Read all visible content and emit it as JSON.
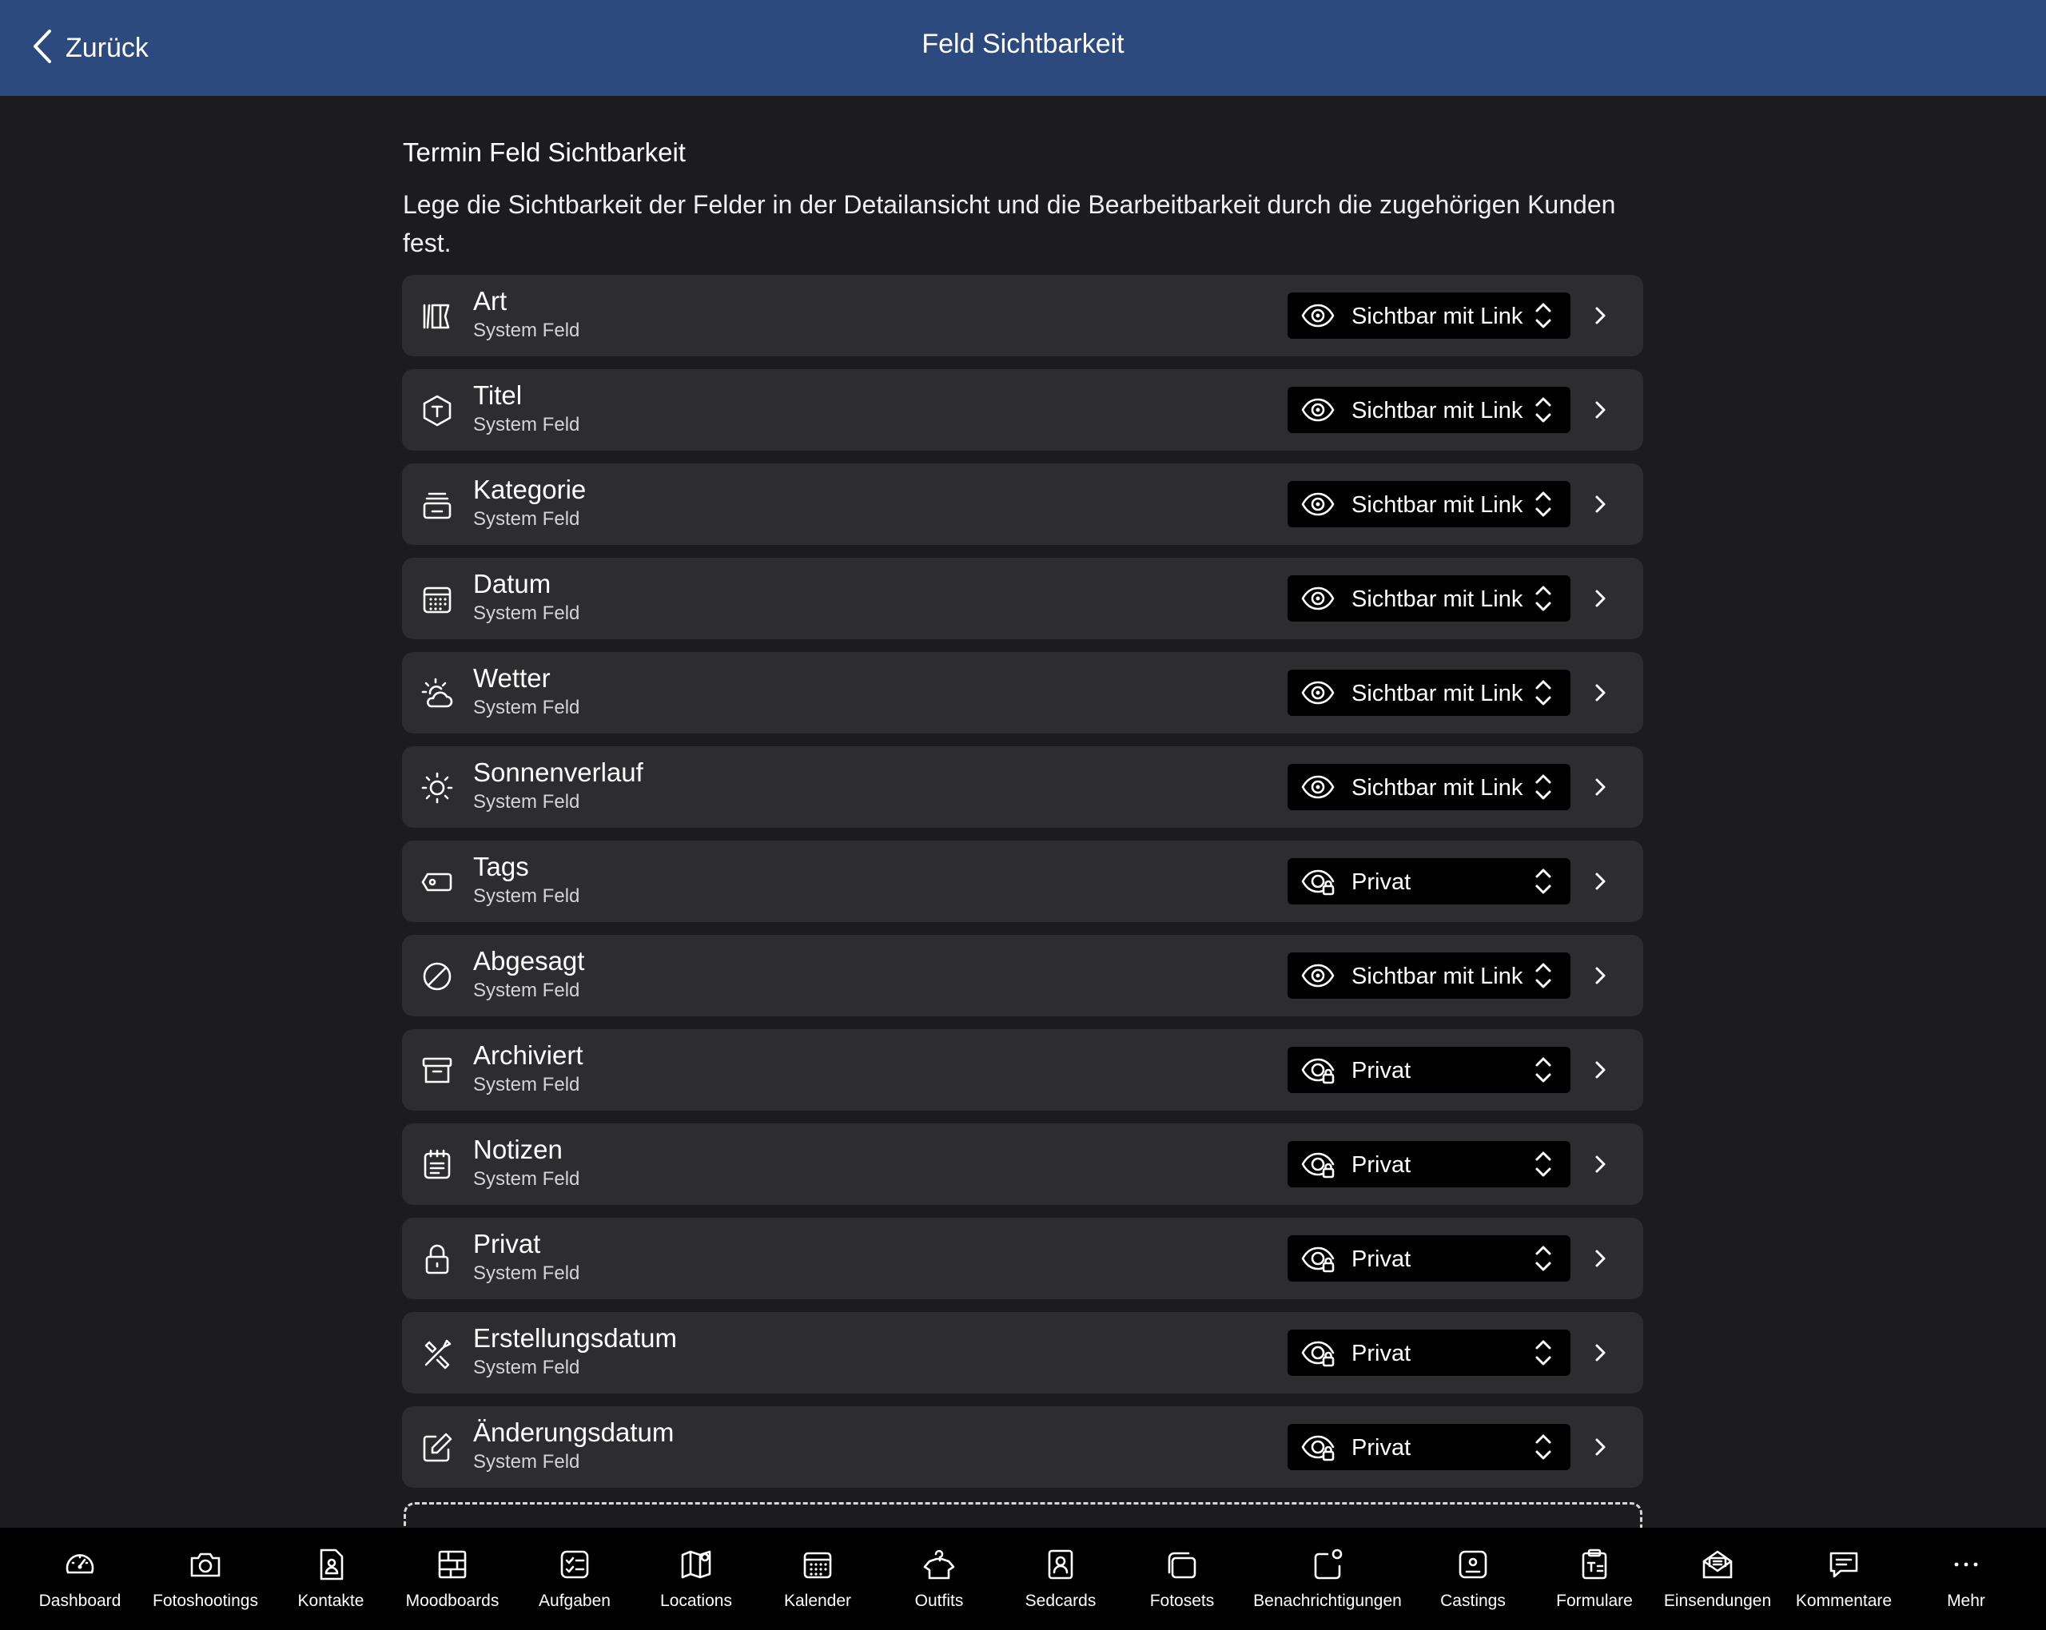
{
  "header": {
    "back_label": "Zurück",
    "title": "Feld Sichtbarkeit"
  },
  "section": {
    "title": "Termin Feld Sichtbarkeit",
    "description": "Lege die Sichtbarkeit der Felder in der Detailansicht und die Bearbeitbarkeit durch die zugehörigen Kunden fest."
  },
  "fields": [
    {
      "name": "Art",
      "subtitle": "System Feld",
      "icon": "columns-icon",
      "visibility": "Sichtbar mit Link",
      "visibility_icon": "eye-icon"
    },
    {
      "name": "Titel",
      "subtitle": "System Feld",
      "icon": "title-hexagon-icon",
      "visibility": "Sichtbar mit Link",
      "visibility_icon": "eye-icon"
    },
    {
      "name": "Kategorie",
      "subtitle": "System Feld",
      "icon": "category-stack-icon",
      "visibility": "Sichtbar mit Link",
      "visibility_icon": "eye-icon"
    },
    {
      "name": "Datum",
      "subtitle": "System Feld",
      "icon": "calendar-icon",
      "visibility": "Sichtbar mit Link",
      "visibility_icon": "eye-icon"
    },
    {
      "name": "Wetter",
      "subtitle": "System Feld",
      "icon": "weather-icon",
      "visibility": "Sichtbar mit Link",
      "visibility_icon": "eye-icon"
    },
    {
      "name": "Sonnenverlauf",
      "subtitle": "System Feld",
      "icon": "sun-icon",
      "visibility": "Sichtbar mit Link",
      "visibility_icon": "eye-icon"
    },
    {
      "name": "Tags",
      "subtitle": "System Feld",
      "icon": "tag-icon",
      "visibility": "Privat",
      "visibility_icon": "eye-lock-icon"
    },
    {
      "name": "Abgesagt",
      "subtitle": "System Feld",
      "icon": "cancelled-icon",
      "visibility": "Sichtbar mit Link",
      "visibility_icon": "eye-icon"
    },
    {
      "name": "Archiviert",
      "subtitle": "System Feld",
      "icon": "archive-icon",
      "visibility": "Privat",
      "visibility_icon": "eye-lock-icon"
    },
    {
      "name": "Notizen",
      "subtitle": "System Feld",
      "icon": "notes-icon",
      "visibility": "Privat",
      "visibility_icon": "eye-lock-icon"
    },
    {
      "name": "Privat",
      "subtitle": "System Feld",
      "icon": "lock-icon",
      "visibility": "Privat",
      "visibility_icon": "eye-lock-icon"
    },
    {
      "name": "Erstellungsdatum",
      "subtitle": "System Feld",
      "icon": "tools-icon",
      "visibility": "Privat",
      "visibility_icon": "eye-lock-icon"
    },
    {
      "name": "Änderungsdatum",
      "subtitle": "System Feld",
      "icon": "edit-icon",
      "visibility": "Privat",
      "visibility_icon": "eye-lock-icon"
    }
  ],
  "tabbar": [
    {
      "label": "Dashboard",
      "icon": "speedometer-icon"
    },
    {
      "label": "Fotoshootings",
      "icon": "camera-icon"
    },
    {
      "label": "Kontakte",
      "icon": "contact-icon"
    },
    {
      "label": "Moodboards",
      "icon": "moodboard-icon"
    },
    {
      "label": "Aufgaben",
      "icon": "tasks-icon"
    },
    {
      "label": "Locations",
      "icon": "map-icon"
    },
    {
      "label": "Kalender",
      "icon": "calendar-icon"
    },
    {
      "label": "Outfits",
      "icon": "hanger-icon"
    },
    {
      "label": "Sedcards",
      "icon": "sedcard-icon"
    },
    {
      "label": "Fotosets",
      "icon": "photosets-icon"
    },
    {
      "label": "Benachrichtigungen",
      "icon": "notification-icon"
    },
    {
      "label": "Castings",
      "icon": "casting-icon"
    },
    {
      "label": "Formulare",
      "icon": "clipboard-icon"
    },
    {
      "label": "Einsendungen",
      "icon": "mail-open-icon"
    },
    {
      "label": "Kommentare",
      "icon": "comment-icon"
    },
    {
      "label": "Mehr",
      "icon": "more-icon"
    }
  ],
  "colors": {
    "header_bg": "#2c4a7d",
    "page_bg": "#1c1c1e",
    "row_bg": "#2d2d2f",
    "select_bg": "#000000",
    "tabbar_bg": "#000000"
  }
}
